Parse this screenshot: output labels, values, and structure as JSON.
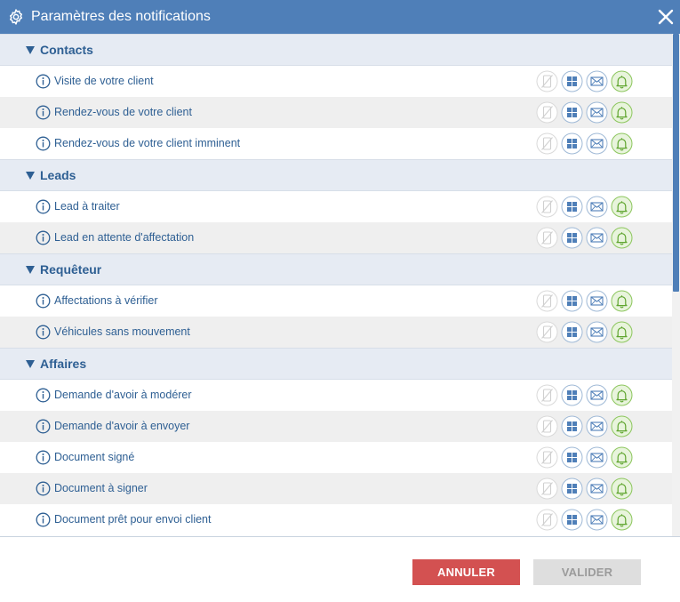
{
  "window": {
    "title": "Paramètres des notifications",
    "title_bg": "#4f7fb8"
  },
  "sections": [
    {
      "title": "Contacts",
      "items": [
        {
          "label": "Visite de votre client"
        },
        {
          "label": "Rendez-vous de votre client"
        },
        {
          "label": "Rendez-vous de votre client imminent"
        }
      ]
    },
    {
      "title": "Leads",
      "items": [
        {
          "label": "Lead à traiter"
        },
        {
          "label": "Lead en attente d'affectation"
        }
      ]
    },
    {
      "title": "Requêteur",
      "items": [
        {
          "label": "Affectations à vérifier"
        },
        {
          "label": "Véhicules sans mouvement"
        }
      ]
    },
    {
      "title": "Affaires",
      "items": [
        {
          "label": "Demande d'avoir à modérer"
        },
        {
          "label": "Demande d'avoir à envoyer"
        },
        {
          "label": "Document signé"
        },
        {
          "label": "Document à signer"
        },
        {
          "label": "Document prêt pour envoi client"
        }
      ]
    }
  ],
  "channel_icons": [
    "mobile-disabled-icon",
    "grid-icon",
    "mail-icon",
    "bell-icon"
  ],
  "colors": {
    "accent": "#4f7fb8",
    "section_bg": "#e6ebf3",
    "text": "#2e5f93",
    "bell_active": "#7cbf4e",
    "cancel": "#d35151",
    "disabled": "#dedede"
  },
  "footer": {
    "cancel_label": "ANNULER",
    "ok_label": "VALIDER"
  }
}
